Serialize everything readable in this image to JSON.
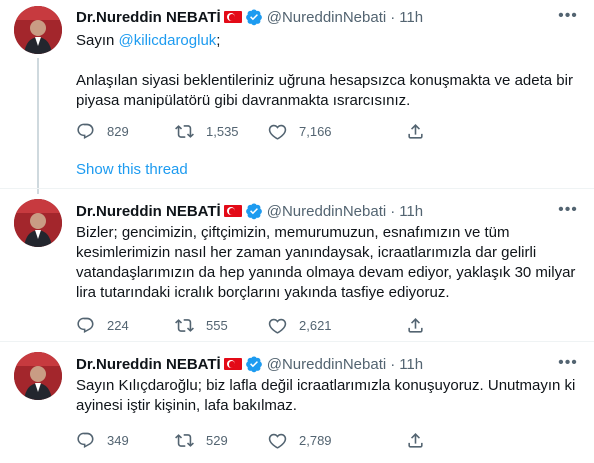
{
  "colors": {
    "accent": "#1d9bf0",
    "muted": "#536471",
    "text": "#0f1419",
    "flag_red": "#e30a17"
  },
  "tweets": [
    {
      "author": "Dr.Nureddin NEBATİ",
      "handle": "@NureddinNebati",
      "dot": "·",
      "time": "11h",
      "text_prefix": "Sayın ",
      "mention": "@kilicdarogluk",
      "text_suffix": ";",
      "text_para2": "Anlaşılan siyasi beklentileriniz uğruna hesapsızca konuşmakta ve adeta bir piyasa manipülatörü gibi davranmakta ısrarcısınız.",
      "reply_count": "829",
      "retweet_count": "1,535",
      "like_count": "7,166",
      "show_thread": "Show this thread"
    },
    {
      "author": "Dr.Nureddin NEBATİ",
      "handle": "@NureddinNebati",
      "dot": "·",
      "time": "11h",
      "text": "Bizler; gencimizin, çiftçimizin, memurumuzun, esnafımızın ve tüm kesimlerimizin nasıl her zaman yanındaysak, icraatlarımızla dar gelirli vatandaşlarımızın da hep yanında olmaya devam ediyor, yaklaşık 30 milyar lira tutarındaki icralık borçlarını yakında tasfiye ediyoruz.",
      "reply_count": "224",
      "retweet_count": "555",
      "like_count": "2,621"
    },
    {
      "author": "Dr.Nureddin NEBATİ",
      "handle": "@NureddinNebati",
      "dot": "·",
      "time": "11h",
      "text": "Sayın Kılıçdaroğlu; biz lafla değil icraatlarımızla konuşuyoruz. Unutmayın ki ayinesi iştir kişinin, lafa bakılmaz.",
      "reply_count": "349",
      "retweet_count": "529",
      "like_count": "2,789"
    }
  ],
  "icons": {
    "reply": "reply-icon",
    "retweet": "retweet-icon",
    "like": "heart-icon",
    "share": "share-icon",
    "more": "more-icon",
    "verified": "verified-badge-icon",
    "flag": "turkey-flag-icon"
  }
}
